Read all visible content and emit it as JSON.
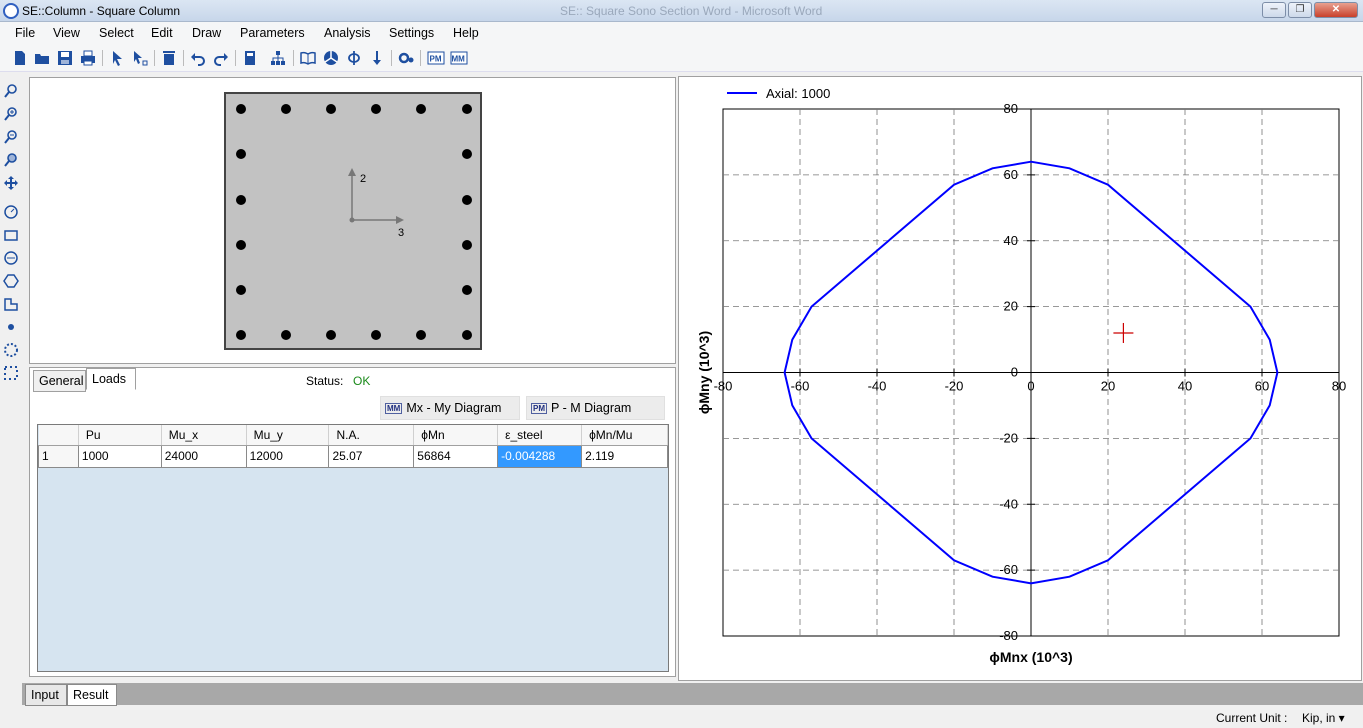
{
  "window": {
    "title": "SE::Column - Square Column",
    "background_title": "SE:: Square Sono Section Word - Microsoft Word"
  },
  "menu": [
    "File",
    "View",
    "Select",
    "Edit",
    "Draw",
    "Parameters",
    "Analysis",
    "Settings",
    "Help"
  ],
  "toolbar": {
    "icons": [
      "new-icon",
      "open-icon",
      "save-icon",
      "print-icon",
      "select-icon",
      "select-node-icon",
      "delete-icon",
      "undo-icon",
      "redo-icon",
      "calculator-icon",
      "hierarchy-icon",
      "book-icon",
      "section-icon",
      "phi-icon",
      "load-arrow-icon",
      "settings-icon",
      "pm-diagram-icon",
      "mm-diagram-icon"
    ],
    "pm_label": "PM",
    "mm_label": "MM"
  },
  "left_tools": [
    "zoom-icon",
    "zoom-in-icon",
    "zoom-out-icon",
    "zoom-window-icon",
    "pan-icon",
    "circle-section-icon",
    "rectangle-section-icon",
    "circle-hole-icon",
    "polygon-section-icon",
    "custom-section-icon",
    "single-bar-icon",
    "circular-bars-icon",
    "rectangular-bars-icon"
  ],
  "section": {
    "axis_2": "2",
    "axis_3": "3",
    "fill_color": "#c2c2c2"
  },
  "results": {
    "tabs": [
      "General",
      "Loads"
    ],
    "active_tab": "Loads",
    "status_label": "Status:",
    "status_value": "OK",
    "buttons": {
      "mm_diagram": "Mx - My Diagram",
      "pm_diagram": "P - M Diagram",
      "mm_icon_label": "MM",
      "pm_icon_label": "PM"
    },
    "columns": [
      "",
      "Pu",
      "Mu_x",
      "Mu_y",
      "N.A.",
      "ϕMn",
      "ε_steel",
      "ϕMn/Mu"
    ],
    "rows": [
      [
        "1",
        "1000",
        "24000",
        "12000",
        "25.07",
        "56864",
        "-0.004288",
        "2.119"
      ]
    ]
  },
  "chart_data": {
    "type": "line",
    "title": "",
    "xlabel": "ϕMnx (10^3)",
    "ylabel": "ϕMny (10^3)",
    "xlim": [
      -80,
      80
    ],
    "ylim": [
      -80,
      80
    ],
    "xticks": [
      -80,
      -60,
      -40,
      -20,
      0,
      20,
      40,
      60,
      80
    ],
    "yticks": [
      -80,
      -60,
      -40,
      -20,
      0,
      20,
      40,
      60,
      80
    ],
    "grid": true,
    "legend_position": "top-left",
    "series": [
      {
        "name": "Axial: 1000",
        "color": "#0000ff",
        "x": [
          0,
          10,
          20,
          57,
          62,
          64,
          62,
          57,
          20,
          10,
          0,
          -10,
          -20,
          -57,
          -62,
          -64,
          -62,
          -57,
          -20,
          -10,
          0
        ],
        "y": [
          64,
          62,
          57,
          20,
          10,
          0,
          -10,
          -20,
          -57,
          -62,
          -64,
          -62,
          -57,
          -20,
          -10,
          0,
          10,
          20,
          57,
          62,
          64
        ]
      }
    ],
    "load_point": {
      "x": 24,
      "y": 12,
      "color": "#cc0000"
    }
  },
  "bottom_tabs": [
    "Input",
    "Result"
  ],
  "active_bottom_tab": "Result",
  "statusbar": {
    "current_unit_label": "Current Unit :",
    "current_unit_value": "Kip, in ▾"
  }
}
